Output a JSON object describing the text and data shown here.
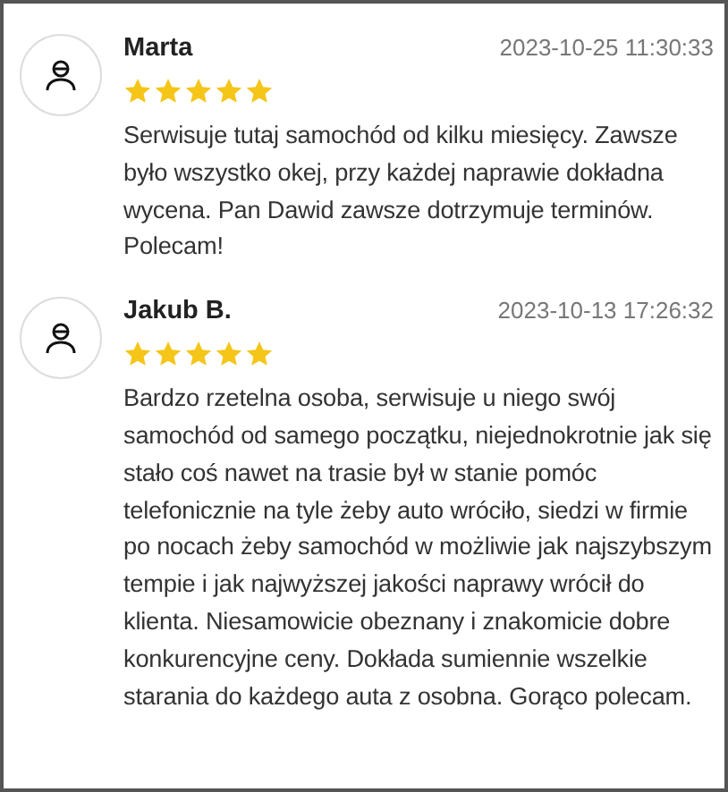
{
  "reviews": [
    {
      "name": "Marta",
      "date": "2023-10-25 11:30:33",
      "stars": 5,
      "text": "Serwisuje tutaj samochód od kilku miesięcy. Zawsze było wszystko okej, przy każdej naprawie dokładna wycena. Pan Dawid zawsze dotrzymuje terminów. Polecam!"
    },
    {
      "name": "Jakub B.",
      "date": "2023-10-13 17:26:32",
      "stars": 5,
      "text": "Bardzo rzetelna osoba, serwisuje u niego swój samochód od samego początku, niejednokrotnie jak się stało coś nawet na trasie był w stanie pomóc telefonicznie na tyle żeby auto wróciło, siedzi w firmie po nocach żeby samochód w możliwie jak najszybszym tempie i jak najwyższej jakości naprawy wrócił do klienta. Niesamowicie obeznany i znakomicie dobre konkurencyjne ceny. Dokłada sumiennie wszelkie starania do każdego auta z osobna. Gorąco polecam."
    }
  ]
}
